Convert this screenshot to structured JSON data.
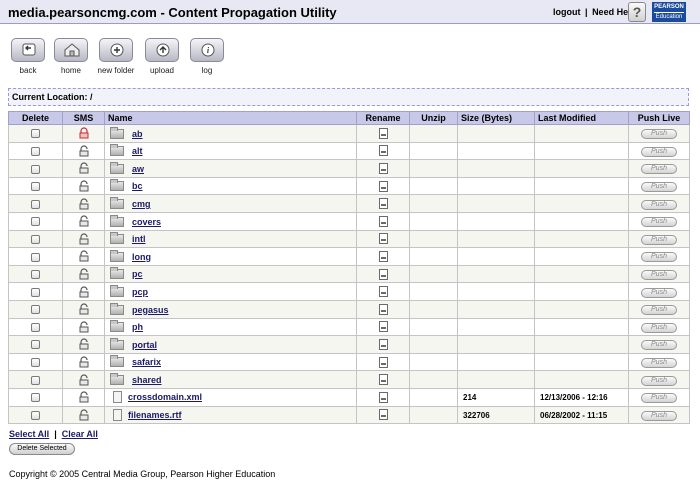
{
  "header": {
    "title": "media.pearsoncmg.com - Content Propagation Utility",
    "logout": "logout",
    "separator": "|",
    "need_help": "Need Help",
    "help_icon": "question-mark-icon",
    "logo_line1": "PEARSON",
    "logo_line2": "Education"
  },
  "toolbar": {
    "back": "back",
    "home": "home",
    "new_folder": "new folder",
    "upload": "upload",
    "log": "log"
  },
  "location": {
    "label": "Current Location: /"
  },
  "table": {
    "columns": {
      "delete": "Delete",
      "sms": "SMS",
      "name": "Name",
      "rename": "Rename",
      "unzip": "Unzip",
      "size": "Size (Bytes)",
      "modified": "Last Modified",
      "push": "Push Live"
    },
    "push_label": "Push",
    "rows": [
      {
        "type": "folder",
        "name": "ab",
        "locked": true,
        "size": "",
        "modified": ""
      },
      {
        "type": "folder",
        "name": "alt",
        "locked": false,
        "size": "",
        "modified": ""
      },
      {
        "type": "folder",
        "name": "aw",
        "locked": false,
        "size": "",
        "modified": ""
      },
      {
        "type": "folder",
        "name": "bc",
        "locked": false,
        "size": "",
        "modified": ""
      },
      {
        "type": "folder",
        "name": "cmg",
        "locked": false,
        "size": "",
        "modified": ""
      },
      {
        "type": "folder",
        "name": "covers",
        "locked": false,
        "size": "",
        "modified": ""
      },
      {
        "type": "folder",
        "name": "intl",
        "locked": false,
        "size": "",
        "modified": ""
      },
      {
        "type": "folder",
        "name": "long",
        "locked": false,
        "size": "",
        "modified": ""
      },
      {
        "type": "folder",
        "name": "pc",
        "locked": false,
        "size": "",
        "modified": ""
      },
      {
        "type": "folder",
        "name": "pcp",
        "locked": false,
        "size": "",
        "modified": ""
      },
      {
        "type": "folder",
        "name": "pegasus",
        "locked": false,
        "size": "",
        "modified": ""
      },
      {
        "type": "folder",
        "name": "ph",
        "locked": false,
        "size": "",
        "modified": ""
      },
      {
        "type": "folder",
        "name": "portal",
        "locked": false,
        "size": "",
        "modified": ""
      },
      {
        "type": "folder",
        "name": "safarix",
        "locked": false,
        "size": "",
        "modified": ""
      },
      {
        "type": "folder",
        "name": "shared",
        "locked": false,
        "size": "",
        "modified": ""
      },
      {
        "type": "file",
        "name": "crossdomain.xml",
        "locked": false,
        "size": "214",
        "modified": "12/13/2006 - 12:16"
      },
      {
        "type": "file",
        "name": "filenames.rtf",
        "locked": false,
        "size": "322706",
        "modified": "06/28/2002 - 11:15"
      }
    ]
  },
  "footer": {
    "select_all": "Select All",
    "separator": "|",
    "clear_all": "Clear All",
    "delete_selected": "Delete Selected",
    "copyright": "Copyright © 2005 Central Media Group, Pearson Higher Education"
  },
  "colors": {
    "header_bg": "#e8e8f4",
    "table_header_bg": "#c8c8e8",
    "link": "#1a1a66",
    "locked_icon": "#c03030"
  }
}
